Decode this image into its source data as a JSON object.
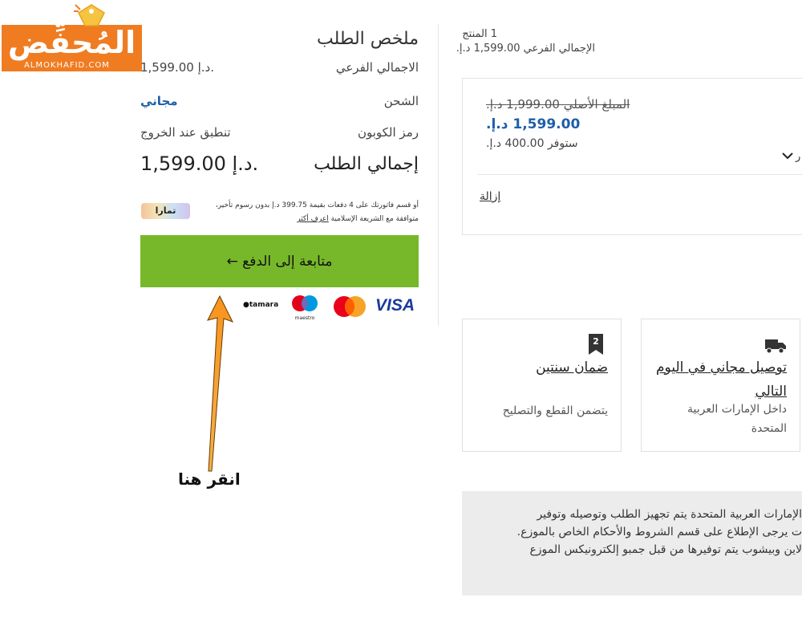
{
  "logo": {
    "text": "المُحفِّض",
    "subtext": "ALMOKHAFID.COM"
  },
  "summary": {
    "title": "ملخص الطلب",
    "subtotal_label": "الاجمالي الفرعي",
    "subtotal_value": "1,599.00 د.إ.",
    "shipping_label": "الشحن",
    "shipping_value": "مجاني",
    "coupon_label": "رمز الكوبون",
    "coupon_value": "تنطبق عند الخروج",
    "total_label": "إجمالي الطلب",
    "total_value": "1,599.00 د.إ."
  },
  "tamara": {
    "line1": "أو قسم فاتورتك على 4 دفعات بقيمة 399.75 د.إ بدون رسوم تأخير،",
    "line2_prefix": "متوافقة مع الشريعة الإسلامية ",
    "learn_more": "اعرف أكثر",
    "badge": "تمارا"
  },
  "checkout": {
    "button_label": "متابعة إلى الدفع ←"
  },
  "payment_methods": {
    "visa": "VISA",
    "maestro": "maestro",
    "tamara": "tamara"
  },
  "product": {
    "count": "1 المنتج",
    "subtotal": "الإجمالي الفرعي 1,599.00 د.إ."
  },
  "price_card": {
    "original": "المبلغ الأصلي 1,999.00 د.إ.",
    "current": "1,599.00 د.إ.",
    "saving": "ستوفر 400.00 د.إ.",
    "cut_text": "ر",
    "remove": "إزالة"
  },
  "features": {
    "delivery_title": "توصيل مجاني في اليوم التالي",
    "delivery_desc": "داخل الإمارات العربية المتحدة",
    "warranty_badge": "2",
    "warranty_title": "ضمان سنتين",
    "warranty_desc": "يتضمن القطع والتصليح"
  },
  "notice": {
    "line1": "الإمارات العربية المتحدة يتم تجهيز الطلب وتوصيله وتوفير",
    "line2": "ت يرجى الإطلاع على قسم الشروط والأحكام الخاص بالموزع.",
    "line3": "لاين وبيشوب يتم توفيرها من قبل جمبو إلكترونيكس الموزع"
  },
  "annotation": {
    "text": "انقر هنا",
    "arrow_color": "#f7941d"
  },
  "colors": {
    "checkout_green": "#77b82a",
    "price_blue": "#1e5ea8",
    "logo_orange": "#f07c22"
  }
}
